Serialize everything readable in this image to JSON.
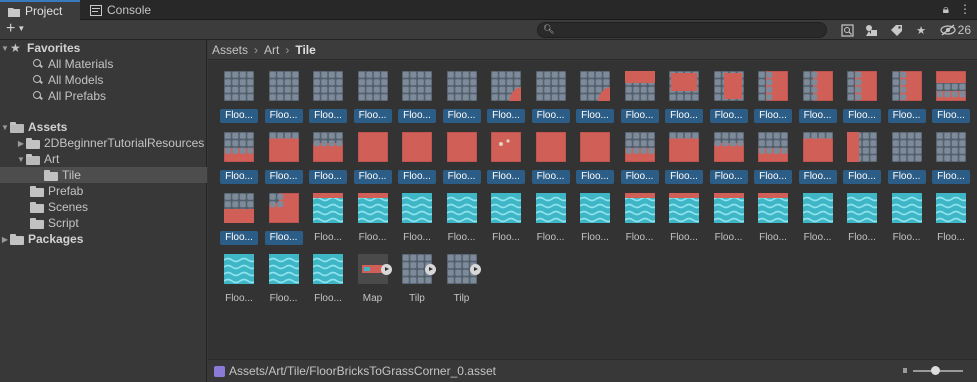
{
  "tabs": {
    "project": "Project",
    "console": "Console"
  },
  "toolbar": {
    "create_label": "+",
    "hidden_count": "26"
  },
  "favorites": {
    "title": "Favorites",
    "items": [
      "All Materials",
      "All Models",
      "All Prefabs"
    ]
  },
  "assets": {
    "title": "Assets",
    "children": [
      "2DBeginnerTutorialResources",
      "Art",
      "Tile",
      "Prefab",
      "Scenes",
      "Script"
    ]
  },
  "packages": {
    "title": "Packages"
  },
  "breadcrumb": {
    "items": [
      "Assets",
      "Art",
      "Tile"
    ]
  },
  "grid": {
    "labels": [
      "Floo...",
      "Floo...",
      "Floo...",
      "Floo...",
      "Floo...",
      "Floo...",
      "Floo...",
      "Floo...",
      "Floo...",
      "Floo...",
      "Floo...",
      "Floo...",
      "Floo...",
      "Floo...",
      "Floo...",
      "Floo...",
      "Floo...",
      "Floo...",
      "Floo...",
      "Floo...",
      "Floo...",
      "Floo...",
      "Floo...",
      "Floo...",
      "Floo...",
      "Floo...",
      "Floo...",
      "Floo...",
      "Floo...",
      "Floo...",
      "Floo...",
      "Floo...",
      "Floo...",
      "Floo...",
      "Floo...",
      "Floo...",
      "Floo...",
      "Floo...",
      "Floo...",
      "Floo...",
      "Floo...",
      "Floo...",
      "Floo...",
      "Floo...",
      "Floo...",
      "Floo...",
      "Floo...",
      "Floo...",
      "Floo...",
      "Floo...",
      "Floo...",
      "Floo...",
      "Floo...",
      "Floo...",
      "Map",
      "Tilp",
      "Tilp"
    ],
    "selected_count": 36,
    "colors": {
      "brick": "#cf5f57",
      "brick_dark": "#b24a44",
      "stone": "#7c8a99",
      "stone_dark": "#55606d",
      "water": "#3fb6c6",
      "water_light": "#8fe3ee",
      "selection": "#2c5d87"
    }
  },
  "status": {
    "path": "Assets/Art/Tile/FloorBricksToGrassCorner_0.asset"
  }
}
